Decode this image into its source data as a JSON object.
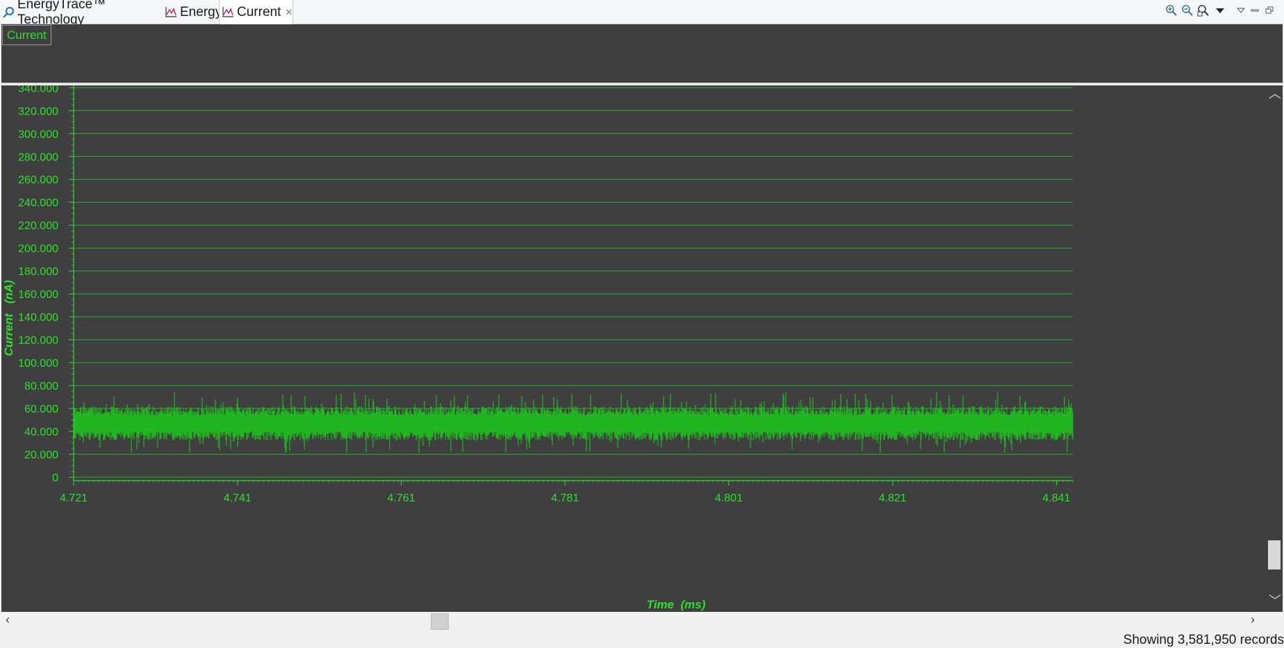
{
  "tabs": [
    {
      "label": "EnergyTrace™ Technology",
      "icon": "energytrace-icon",
      "active": false
    },
    {
      "label": "Energy",
      "icon": "chart-icon",
      "active": false
    },
    {
      "label": "Current",
      "icon": "chart-icon",
      "active": true
    }
  ],
  "toolbar": {
    "buttons": [
      "zoom-in-icon",
      "zoom-out-icon",
      "zoom-reset-icon",
      "dropdown-arrow-icon",
      "view-menu-icon",
      "minimize-icon",
      "restore-icon"
    ]
  },
  "legend": {
    "label": "Current"
  },
  "chart_data": {
    "type": "line",
    "series": [
      {
        "name": "Current",
        "color": "#22b522",
        "approx_range": [
          20,
          75
        ],
        "approx_mean": 47
      }
    ],
    "xlabel": "Time  (ms)",
    "ylabel": "Current   (nA)",
    "xticks": [
      "4.721",
      "4.741",
      "4.761",
      "4.781",
      "4.801",
      "4.821",
      "4.841"
    ],
    "xlim": [
      4.721,
      4.843
    ],
    "yticks": [
      "0",
      "20.000",
      "40.000",
      "60.000",
      "80.000",
      "100.000",
      "120.000",
      "140.000",
      "160.000",
      "180.000",
      "200.000",
      "220.000",
      "240.000",
      "260.000",
      "280.000",
      "300.000",
      "320.000",
      "340.000"
    ],
    "ylim": [
      -3,
      342
    ],
    "grid": true,
    "colors": {
      "axis": "#2ce12c",
      "grid": "#2fb02f",
      "background": "#3f3f3f"
    }
  },
  "status": {
    "text": "Showing 3,581,950 records"
  }
}
